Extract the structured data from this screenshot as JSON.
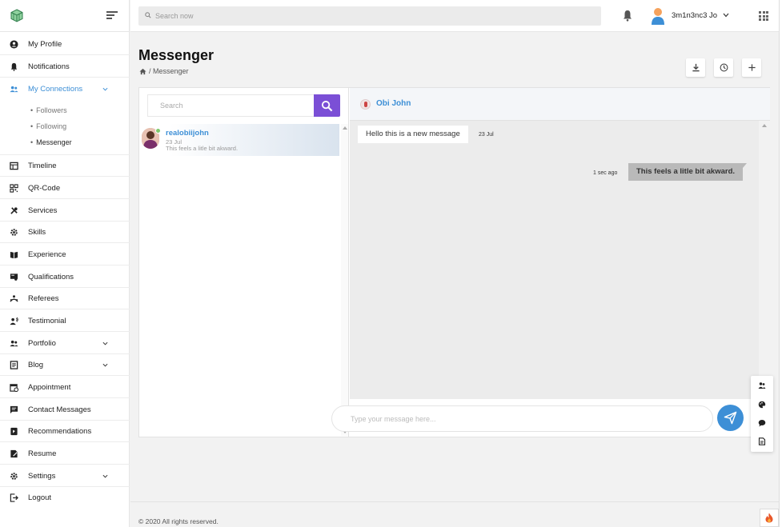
{
  "topbar": {
    "search_placeholder": "Search now",
    "username": "3m1n3nc3 Jo"
  },
  "sidebar": {
    "items": [
      {
        "label": "My Profile",
        "icon": "user-circle-icon"
      },
      {
        "label": "Notifications",
        "icon": "bell-icon"
      },
      {
        "label": "My Connections",
        "icon": "users-icon",
        "active": true,
        "expanded": true
      },
      {
        "label": "Timeline",
        "icon": "timeline-icon"
      },
      {
        "label": "QR-Code",
        "icon": "qr-code-icon"
      },
      {
        "label": "Services",
        "icon": "tools-icon"
      },
      {
        "label": "Skills",
        "icon": "cog-icon"
      },
      {
        "label": "Experience",
        "icon": "book-icon"
      },
      {
        "label": "Qualifications",
        "icon": "certificate-icon"
      },
      {
        "label": "Referees",
        "icon": "referees-icon"
      },
      {
        "label": "Testimonial",
        "icon": "testimonial-icon"
      },
      {
        "label": "Portfolio",
        "icon": "portfolio-icon",
        "has_children": true
      },
      {
        "label": "Blog",
        "icon": "blog-icon",
        "has_children": true
      },
      {
        "label": "Appointment",
        "icon": "calendar-icon"
      },
      {
        "label": "Contact Messages",
        "icon": "message-icon"
      },
      {
        "label": "Recommendations",
        "icon": "recommend-icon"
      },
      {
        "label": "Resume",
        "icon": "resume-icon"
      },
      {
        "label": "Settings",
        "icon": "settings-icon",
        "has_children": true
      },
      {
        "label": "Logout",
        "icon": "logout-icon"
      }
    ],
    "connections_sub": [
      {
        "label": "Followers"
      },
      {
        "label": "Following"
      },
      {
        "label": "Messenger",
        "current": true
      }
    ]
  },
  "page": {
    "title": "Messenger",
    "breadcrumb": "/ Messenger"
  },
  "messenger": {
    "search_placeholder": "Search",
    "contacts": [
      {
        "name": "realobiijohn",
        "date": "23 Jul",
        "preview": "This feels a litle bit akward.",
        "online": true
      }
    ],
    "chat": {
      "name": "Obi John",
      "messages": [
        {
          "direction": "in",
          "text": "Hello this is a new message",
          "time": "23 Jul"
        },
        {
          "direction": "out",
          "text": "This feels a litle bit akward.",
          "time": "1 sec ago"
        }
      ],
      "composer_placeholder": "Type your message here..."
    }
  },
  "footer": {
    "text": "© 2020 All rights reserved."
  },
  "colors": {
    "accent_blue": "#3d8fd6",
    "search_purple": "#7b4fd6",
    "online_green": "#7ec96a"
  }
}
